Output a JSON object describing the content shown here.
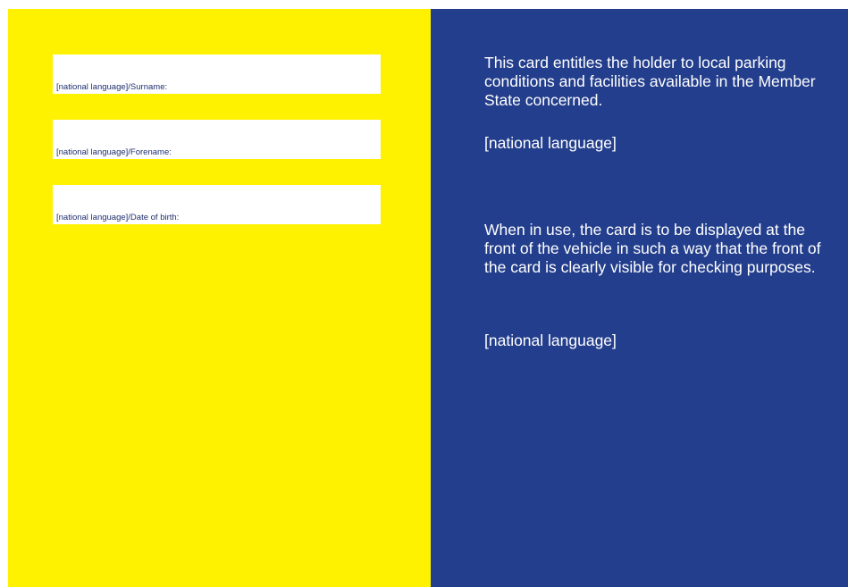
{
  "colors": {
    "left_background": "#fff200",
    "right_background": "#233e8c",
    "field_background": "#ffffff",
    "field_label_text": "#1e2f6e",
    "right_text": "#ffffff"
  },
  "left": {
    "fields": [
      {
        "label": "[national language]/Surname:"
      },
      {
        "label": "[national language]/Forename:"
      },
      {
        "label": "[national language]/Date of birth:"
      }
    ]
  },
  "right": {
    "paragraph1": "This card entitles the holder to local parking conditions and facilities available in the Member State concerned.",
    "national1": "[national language]",
    "paragraph2": "When in use, the card is to be displayed at the front of the vehicle in such a way that the front of the card is clearly visible for checking purposes.",
    "national2": "[national language]"
  }
}
